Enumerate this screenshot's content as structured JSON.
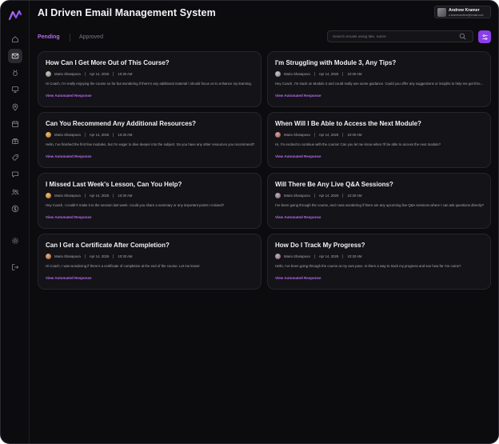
{
  "app": {
    "title": "AI Driven Email Management System"
  },
  "user": {
    "name": "Andrew Kramer",
    "email": "a.kramerandrew@email.com"
  },
  "tabs": {
    "pending": "Pending",
    "approved": "Approved"
  },
  "search": {
    "placeholder": "Search emails using title, name",
    "value": ""
  },
  "colors": {
    "accent": "#8b3fe8",
    "accent_text": "#b86cf0",
    "background": "#0c0b0e",
    "card": "#141317"
  },
  "sidebar": {
    "items": [
      {
        "name": "home-icon",
        "active": false
      },
      {
        "name": "mail-icon",
        "active": true
      },
      {
        "name": "medal-icon",
        "active": false
      },
      {
        "name": "presentation-icon",
        "active": false
      },
      {
        "name": "map-pin-icon",
        "active": false
      },
      {
        "name": "calendar-icon",
        "active": false
      },
      {
        "name": "gift-icon",
        "active": false
      },
      {
        "name": "tag-icon",
        "active": false
      },
      {
        "name": "chat-icon",
        "active": false
      },
      {
        "name": "users-icon",
        "active": false
      },
      {
        "name": "dollar-icon",
        "active": false
      },
      {
        "name": "settings-icon",
        "active": false
      },
      {
        "name": "logout-icon",
        "active": false
      }
    ]
  },
  "emails": [
    {
      "title": "How Can I Get More Out of This Course?",
      "sender": "Maria Sharapova",
      "date": "Apr 14, 2025",
      "time": "10:30 AM",
      "preview": "Hi Coach, I'm really enjoying the course so far but wondering if there's any additional material I should focus on to enhance my learning.",
      "link": "View Automated Response"
    },
    {
      "title": "I'm Struggling with Module 3, Any Tips?",
      "sender": "Maria Sharapova",
      "date": "Apr 14, 2025",
      "time": "10:30 AM",
      "preview": "Hey Coach, I'm stuck on Module 3 and could really use some guidance. Could you offer any suggestions or insights to help me get through it?",
      "link": "View Automated Response"
    },
    {
      "title": "Can You Recommend Any Additional Resources?",
      "sender": "Maria Sharapova",
      "date": "Apr 14, 2025",
      "time": "10:30 AM",
      "preview": "Hello, I've finished the first few modules, but I'm eager to dive deeper into the subject. Do you have any other resources you recommend?",
      "link": "View Automated Response"
    },
    {
      "title": "When Will I Be Able to Access the Next Module?",
      "sender": "Maria Sharapova",
      "date": "Apr 14, 2025",
      "time": "10:30 AM",
      "preview": "Hi, I'm excited to continue with the course! Can you let me know when I'll be able to access the next module?",
      "link": "View Automated Response"
    },
    {
      "title": "I Missed Last Week's Lesson, Can You Help?",
      "sender": "Maria Sharapova",
      "date": "Apr 14, 2025",
      "time": "10:30 AM",
      "preview": "Hey Coach, I couldn't make it to the session last week. Could you share a summary or any important points I missed?",
      "link": "View Automated Response"
    },
    {
      "title": "Will There Be Any Live Q&A Sessions?",
      "sender": "Maria Sharapova",
      "date": "Apr 14, 2025",
      "time": "10:30 AM",
      "preview": "I've been going through the course, and I was wondering if there are any upcoming live Q&A sessions where I can ask questions directly?",
      "link": "View Automated Response"
    },
    {
      "title": "Can I Get a Certificate After Completion?",
      "sender": "Maria Sharapova",
      "date": "Apr 14, 2025",
      "time": "10:30 AM",
      "preview": "Hi Coach, I was wondering if there's a certificate of completion at the end of the course. Let me know!",
      "link": "View Automated Response"
    },
    {
      "title": "How Do I Track My Progress?",
      "sender": "Maria Sharapova",
      "date": "Apr 14, 2025",
      "time": "10:30 AM",
      "preview": "Hello, I've been going through the course at my own pace. Is there a way to track my progress and see how far I've come?",
      "link": "View Automated Response"
    }
  ]
}
